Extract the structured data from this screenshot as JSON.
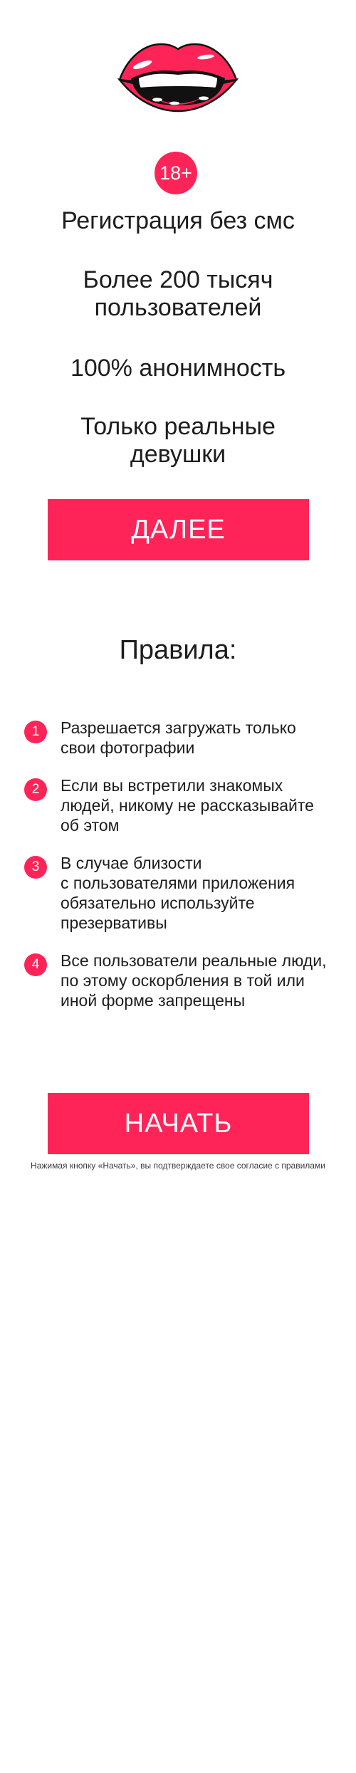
{
  "brand": {
    "accent_color": "#ff2458",
    "logo_icon": "lips-icon"
  },
  "age_badge": {
    "label": "18+"
  },
  "features": [
    {
      "line1": "Регистрация без смс",
      "line2": ""
    },
    {
      "line1": "Более 200 тысяч",
      "line2": "пользователей"
    },
    {
      "line1": "100% анонимность",
      "line2": ""
    },
    {
      "line1": "Только реальные",
      "line2": "девушки"
    }
  ],
  "buttons": {
    "next": "ДАЛЕЕ",
    "start": "НАЧАТЬ"
  },
  "rules": {
    "title": "Правила:",
    "items": [
      {
        "number": "1",
        "lines": [
          "Разрешается загружать только",
          "свои фотографии"
        ]
      },
      {
        "number": "2",
        "lines": [
          "Если вы встретили знакомых",
          "людей, никому не рассказывайте",
          "об этом"
        ]
      },
      {
        "number": "3",
        "lines": [
          "В случае близости",
          "с пользователями приложения",
          "обязательно используйте",
          "презервативы"
        ]
      },
      {
        "number": "4",
        "lines": [
          "Все пользователи реальные люди,",
          "по этому оскорбления в той или",
          "иной форме запрещены"
        ]
      }
    ]
  },
  "footer": {
    "consent_text": "Нажимая кнопку «Начать», вы подтверждаете свое согласие с правилами"
  }
}
